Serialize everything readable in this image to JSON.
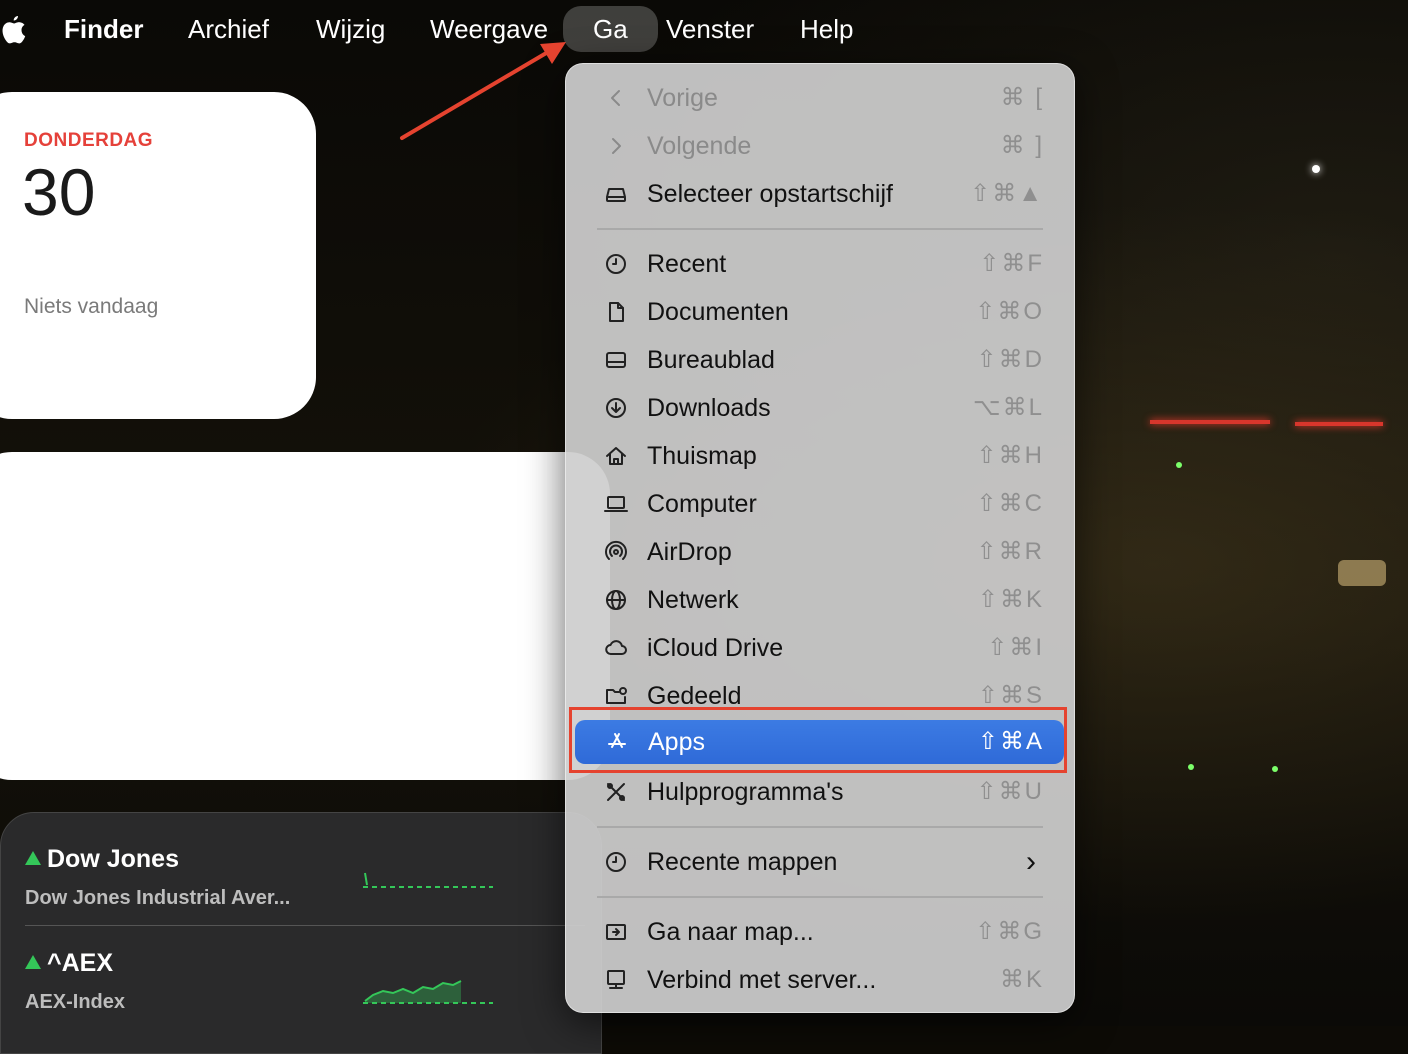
{
  "menubar": {
    "items": [
      "Finder",
      "Archief",
      "Wijzig",
      "Weergave",
      "Ga",
      "Venster",
      "Help"
    ]
  },
  "calendar_widget": {
    "weekday": "DONDERDAG",
    "day": "30",
    "empty_text": "Niets vandaag"
  },
  "stocks_widget": {
    "rows": [
      {
        "symbol": "Dow Jones",
        "name": "Dow Jones Industrial Aver...",
        "trend": "up"
      },
      {
        "symbol": "^AEX",
        "name": "AEX-Index",
        "trend": "up"
      }
    ]
  },
  "go_menu": {
    "items": [
      {
        "label": "Vorige",
        "shortcut": "⌘ [",
        "icon": "chevron-left-icon",
        "disabled": true
      },
      {
        "label": "Volgende",
        "shortcut": "⌘ ]",
        "icon": "chevron-right-icon",
        "disabled": true
      },
      {
        "label": "Selecteer opstartschijf",
        "shortcut": "⇧⌘▲",
        "icon": "drive-icon"
      },
      {
        "label": "Recent",
        "shortcut": "⇧⌘F",
        "icon": "clock-icon"
      },
      {
        "label": "Documenten",
        "shortcut": "⇧⌘O",
        "icon": "document-icon"
      },
      {
        "label": "Bureaublad",
        "shortcut": "⇧⌘D",
        "icon": "desktop-icon"
      },
      {
        "label": "Downloads",
        "shortcut": "⌥⌘L",
        "icon": "download-icon"
      },
      {
        "label": "Thuismap",
        "shortcut": "⇧⌘H",
        "icon": "home-icon"
      },
      {
        "label": "Computer",
        "shortcut": "⇧⌘C",
        "icon": "laptop-icon"
      },
      {
        "label": "AirDrop",
        "shortcut": "⇧⌘R",
        "icon": "airdrop-icon"
      },
      {
        "label": "Netwerk",
        "shortcut": "⇧⌘K",
        "icon": "globe-icon"
      },
      {
        "label": "iCloud Drive",
        "shortcut": "⇧⌘I",
        "icon": "cloud-icon"
      },
      {
        "label": "Gedeeld",
        "shortcut": "⇧⌘S",
        "icon": "shared-folder-icon"
      },
      {
        "label": "Apps",
        "shortcut": "⇧⌘A",
        "icon": "apps-icon",
        "highlighted": true
      },
      {
        "label": "Hulpprogramma's",
        "shortcut": "⇧⌘U",
        "icon": "tools-icon"
      },
      {
        "label": "Recente mappen",
        "shortcut": "›",
        "icon": "clock-icon"
      },
      {
        "label": "Ga naar map...",
        "shortcut": "⇧⌘G",
        "icon": "go-folder-icon"
      },
      {
        "label": "Verbind met server...",
        "shortcut": "⌘K",
        "icon": "server-icon"
      }
    ]
  },
  "colors": {
    "highlight": "#2f6ad8",
    "annotation": "#e5432f",
    "calendar_weekday": "#e5413a",
    "stock_up": "#34c759"
  }
}
